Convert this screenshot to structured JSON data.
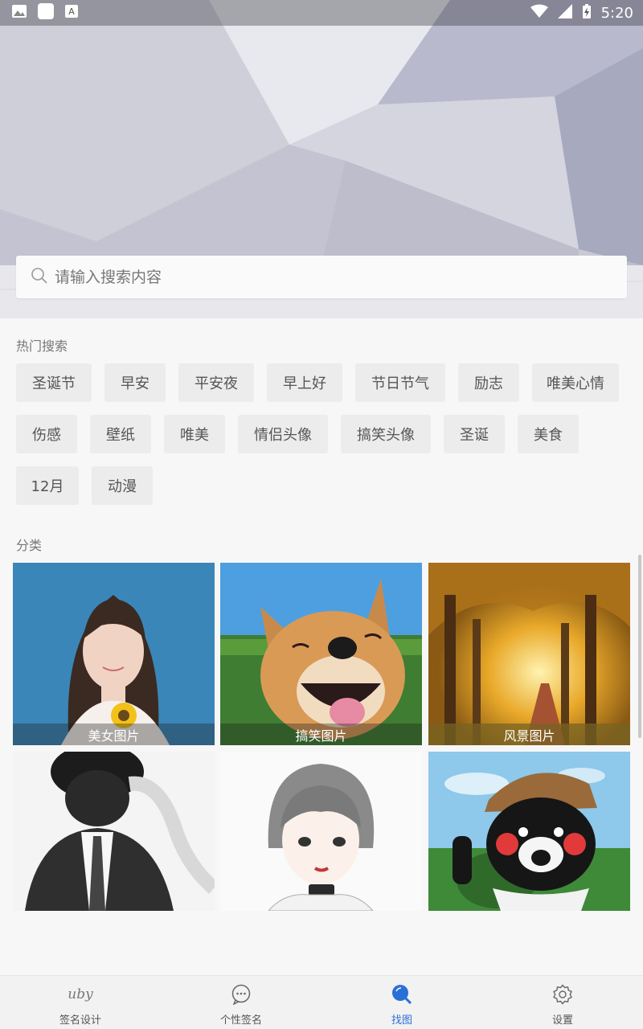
{
  "status_bar": {
    "time": "5:20",
    "icons": [
      "image-icon",
      "app-icon",
      "font-icon",
      "wifi-icon",
      "signal-icon",
      "battery-charging-icon"
    ]
  },
  "search": {
    "placeholder": "请输入搜索内容",
    "value": ""
  },
  "hot_search": {
    "title": "热门搜索",
    "tags": [
      "圣诞节",
      "早安",
      "平安夜",
      "早上好",
      "节日节气",
      "励志",
      "唯美心情",
      "伤感",
      "壁纸",
      "唯美",
      "情侣头像",
      "搞笑头像",
      "圣诞",
      "美食",
      "12月",
      "动漫"
    ]
  },
  "categories": {
    "title": "分类",
    "items": [
      {
        "label": "美女图片"
      },
      {
        "label": "搞笑图片"
      },
      {
        "label": "风景图片"
      },
      {
        "label": ""
      },
      {
        "label": ""
      },
      {
        "label": ""
      }
    ]
  },
  "bottom_nav": {
    "items": [
      {
        "label": "签名设计",
        "icon": "signature-icon",
        "active": false
      },
      {
        "label": "个性签名",
        "icon": "chat-bubble-icon",
        "active": false
      },
      {
        "label": "找图",
        "icon": "search-icon",
        "active": true
      },
      {
        "label": "设置",
        "icon": "gear-icon",
        "active": false
      }
    ],
    "signature_icon_text": "uby"
  },
  "colors": {
    "accent": "#2a6fd6",
    "caret": "#d23a5a"
  }
}
